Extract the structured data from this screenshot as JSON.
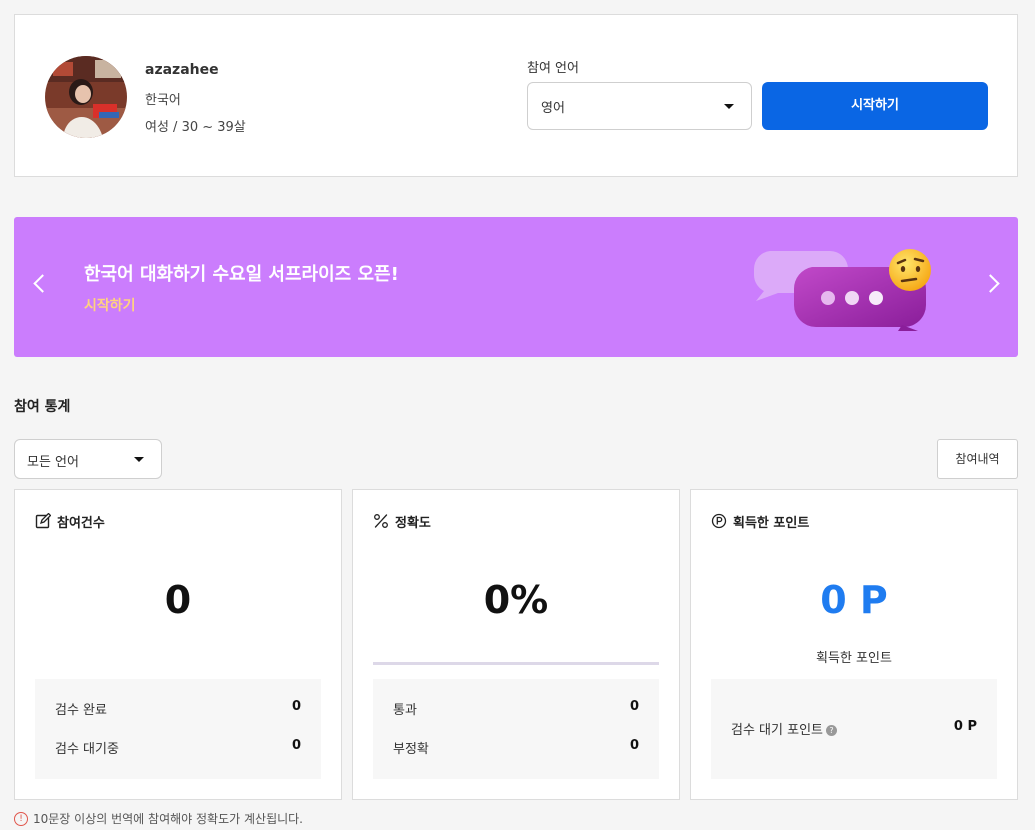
{
  "profile": {
    "username": "azazahee",
    "native_language": "한국어",
    "demographic": "여성 / 30 ~ 39살",
    "language_label": "참여 언어",
    "language_selected": "영어",
    "start_button": "시작하기"
  },
  "banner": {
    "title": "한국어 대화하기 수요일 서프라이즈 오픈!",
    "cta": "시작하기",
    "icons": [
      "chevron-left-icon",
      "chevron-right-icon",
      "chat-bubble-emoji-illustration"
    ]
  },
  "stats": {
    "section_title": "참여 통계",
    "filter_selected": "모든 언어",
    "history_button": "참여내역",
    "cards": [
      {
        "icon": "edit-icon",
        "title": "참여건수",
        "value": "0",
        "rows": [
          {
            "label": "검수 완료",
            "value": "0"
          },
          {
            "label": "검수 대기중",
            "value": "0"
          }
        ]
      },
      {
        "icon": "percent-icon",
        "title": "정확도",
        "value": "0%",
        "progress": 0,
        "rows": [
          {
            "label": "통과",
            "value": "0"
          },
          {
            "label": "부정확",
            "value": "0"
          }
        ]
      },
      {
        "icon": "point-icon",
        "title": "획득한 포인트",
        "value": "0 P",
        "caption": "획득한 포인트",
        "rows": [
          {
            "label": "검수 대기 포인트",
            "value": "0 P"
          }
        ]
      }
    ]
  },
  "footnote": "10문장 이상의 번역에 참여해야 정확도가 계산됩니다.",
  "colors": {
    "primary": "#0a66e4",
    "banner_bg": "#cb7dfd",
    "banner_cta": "#ffd27f",
    "points_value": "#1f7cf0",
    "warning": "#e0564c"
  }
}
